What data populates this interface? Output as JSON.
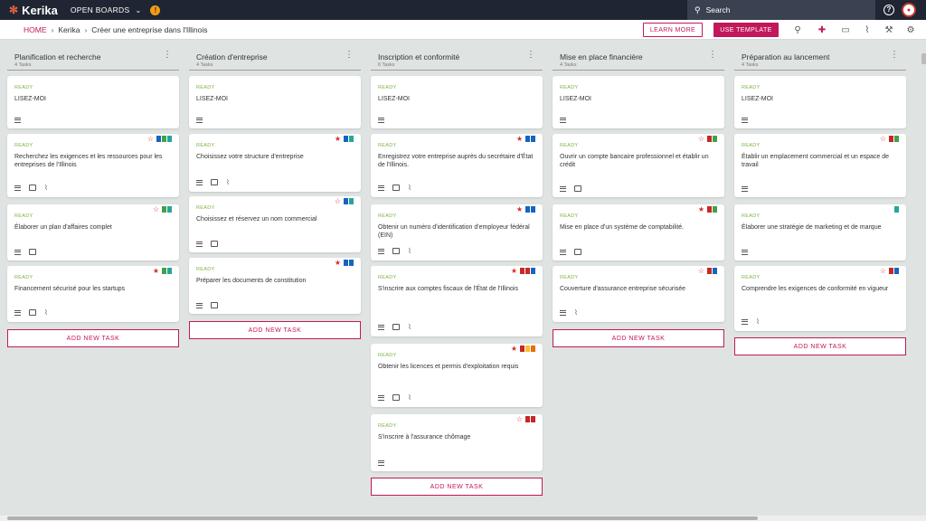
{
  "topbar": {
    "logo": "Kerika",
    "open_boards": "OPEN BOARDS",
    "search_placeholder": "Search"
  },
  "subbar": {
    "breadcrumb": [
      "HOME",
      "Kerika",
      "Créer une entreprise dans l'Illinois"
    ],
    "learn_more": "LEARN MORE",
    "use_template": "USE TEMPLATE"
  },
  "colors": {
    "accent": "#c2185b",
    "ready": "#7cb342",
    "topbar": "#1f2532"
  },
  "columns": [
    {
      "title": "Planification et recherche",
      "count": "4 Tasks",
      "add": "ADD NEW TASK",
      "cards": [
        {
          "status": "READY",
          "title": "LISEZ-MOI"
        },
        {
          "status": "READY",
          "title": "Recherchez les exigences et les ressources pour les entreprises de l'Illinois"
        },
        {
          "status": "READY",
          "title": "Élaborer un plan d'affaires complet"
        },
        {
          "status": "READY",
          "title": "Financement sécurisé pour les startups"
        }
      ]
    },
    {
      "title": "Création d'entreprise",
      "count": "4 Tasks",
      "add": "ADD NEW TASK",
      "cards": [
        {
          "status": "READY",
          "title": "LISEZ-MOI"
        },
        {
          "status": "READY",
          "title": "Choisissez votre structure d'entreprise"
        },
        {
          "status": "READY",
          "title": "Choisissez et réservez un nom commercial"
        },
        {
          "status": "READY",
          "title": "Préparer les documents de constitution"
        }
      ]
    },
    {
      "title": "Inscription et conformité",
      "count": "6 Tasks",
      "add": "ADD NEW TASK",
      "cards": [
        {
          "status": "READY",
          "title": "LISEZ-MOI"
        },
        {
          "status": "READY",
          "title": "Enregistrez votre entreprise auprès du secrétaire d'État de l'Illinois."
        },
        {
          "status": "READY",
          "title": "Obtenir un numéro d'identification d'employeur fédéral (EIN)"
        },
        {
          "status": "READY",
          "title": "S'inscrire aux comptes fiscaux de l'État de l'Illinois"
        },
        {
          "status": "READY",
          "title": "Obtenir les licences et permis d'exploitation requis"
        },
        {
          "status": "READY",
          "title": "S'inscrire à l'assurance chômage"
        }
      ]
    },
    {
      "title": "Mise en place financière",
      "count": "4 Tasks",
      "add": "ADD NEW TASK",
      "cards": [
        {
          "status": "READY",
          "title": "LISEZ-MOI"
        },
        {
          "status": "READY",
          "title": "Ouvrir un compte bancaire professionnel et établir un crédit"
        },
        {
          "status": "READY",
          "title": "Mise en place d'un système de comptabilité."
        },
        {
          "status": "READY",
          "title": "Couverture d'assurance entreprise sécurisée"
        }
      ]
    },
    {
      "title": "Préparation au lancement",
      "count": "4 Tasks",
      "add": "ADD NEW TASK",
      "cards": [
        {
          "status": "READY",
          "title": "LISEZ-MOI"
        },
        {
          "status": "READY",
          "title": "Établir un emplacement commercial et un espace de travail"
        },
        {
          "status": "READY",
          "title": "Élaborer une stratégie de marketing et de marque"
        },
        {
          "status": "READY",
          "title": "Comprendre les exigences de conformité en vigueur"
        }
      ]
    }
  ]
}
